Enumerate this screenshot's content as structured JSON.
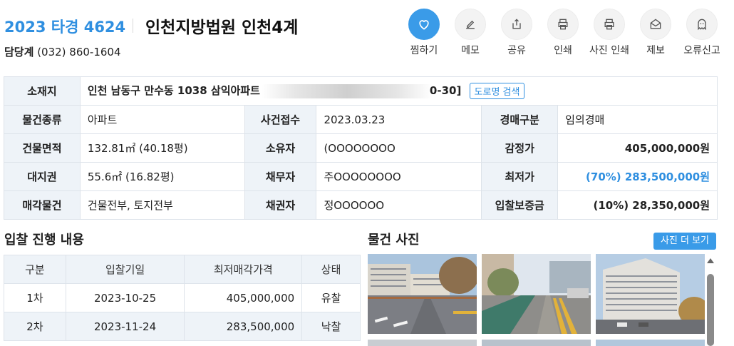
{
  "header": {
    "case_no": "2023 타경 4624",
    "court": "인천지방법원 인천4계",
    "contact_label": "담당계",
    "contact_phone": "(032) 860-1604"
  },
  "actions": [
    {
      "label": "찜하기",
      "icon": "heart-icon"
    },
    {
      "label": "메모",
      "icon": "edit-icon"
    },
    {
      "label": "공유",
      "icon": "share-icon"
    },
    {
      "label": "인쇄",
      "icon": "print-icon"
    },
    {
      "label": "사진 인쇄",
      "icon": "print-photo-icon"
    },
    {
      "label": "제보",
      "icon": "report-mail-icon"
    },
    {
      "label": "오류신고",
      "icon": "ghost-icon"
    }
  ],
  "info": {
    "location_label": "소재지",
    "location_value_start": "인천 남동구 만수동 1038 삼익아파트",
    "location_value_end": "0-30]",
    "road_search": "도로명 검색",
    "rows": [
      {
        "l1": "물건종류",
        "v1": "아파트",
        "l2": "사건접수",
        "v2": "2023.03.23",
        "l3": "경매구분",
        "v3": "임의경매"
      },
      {
        "l1": "건물면적",
        "v1": "132.81㎡ (40.18평)",
        "l2": "소유자",
        "v2": "(OOOOOOOO",
        "l3": "감정가",
        "v3": "405,000,000원"
      },
      {
        "l1": "대지권",
        "v1": "55.6㎡ (16.82평)",
        "l2": "채무자",
        "v2": "주OOOOOOOO",
        "l3": "최저가",
        "v3": "(70%) 283,500,000원"
      },
      {
        "l1": "매각물건",
        "v1": "건물전부, 토지전부",
        "l2": "채권자",
        "v2": "정OOOOOO",
        "l3": "입찰보증금",
        "v3": "(10%) 28,350,000원"
      }
    ]
  },
  "bidding": {
    "title": "입찰 진행 내용",
    "headers": [
      "구분",
      "입찰기일",
      "최저매각가격",
      "상태"
    ],
    "rows": [
      {
        "round": "1차",
        "date": "2023-10-25",
        "price": "405,000,000",
        "status": "유찰"
      },
      {
        "round": "2차",
        "date": "2023-11-24",
        "price": "283,500,000",
        "status": "낙찰"
      }
    ]
  },
  "photos": {
    "title": "물건 사진",
    "more_button": "사진 더 보기"
  },
  "colors": {
    "accent": "#2f8fe0",
    "header_bg": "#eef3f8",
    "border": "#dde3ea"
  }
}
